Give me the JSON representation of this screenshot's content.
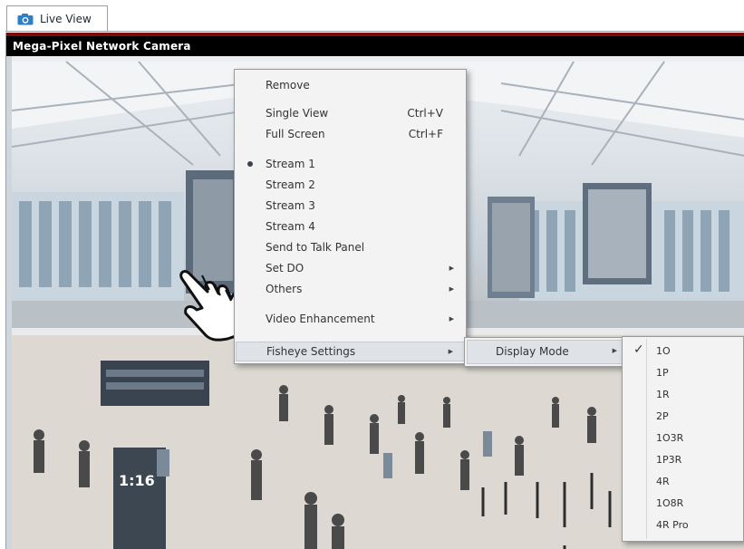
{
  "tab": {
    "label": "Live View",
    "icon": "camera-icon"
  },
  "camera": {
    "title": "Mega-Pixel Network Camera"
  },
  "context_menu": {
    "items": [
      {
        "label": "Remove",
        "shortcut": ""
      },
      {
        "label": "Single View",
        "shortcut": "Ctrl+V"
      },
      {
        "label": "Full Screen",
        "shortcut": "Ctrl+F"
      },
      {
        "label": "Stream 1",
        "shortcut": "",
        "selected": true
      },
      {
        "label": "Stream 2",
        "shortcut": ""
      },
      {
        "label": "Stream 3",
        "shortcut": ""
      },
      {
        "label": "Stream 4",
        "shortcut": ""
      },
      {
        "label": "Send to Talk Panel",
        "shortcut": ""
      },
      {
        "label": "Set DO",
        "shortcut": "",
        "submenu": true
      },
      {
        "label": "Others",
        "shortcut": "",
        "submenu": true
      },
      {
        "label": "Video Enhancement",
        "shortcut": "",
        "submenu": true
      },
      {
        "label": "Fisheye Settings",
        "shortcut": "",
        "submenu": true,
        "highlighted": true
      }
    ]
  },
  "fisheye_submenu": {
    "label": "Display Mode"
  },
  "display_mode_submenu": {
    "selected": "1O",
    "items": [
      "1O",
      "1P",
      "1R",
      "2P",
      "1O3R",
      "1P3R",
      "4R",
      "1O8R",
      "4R Pro"
    ]
  },
  "scene_signs": {
    "timer": "1:16"
  },
  "colors": {
    "title_bar": "#000000",
    "title_accent": "#7a0c0c",
    "menu_bg": "#f3f3f3",
    "highlight": "#dfe3e8"
  }
}
